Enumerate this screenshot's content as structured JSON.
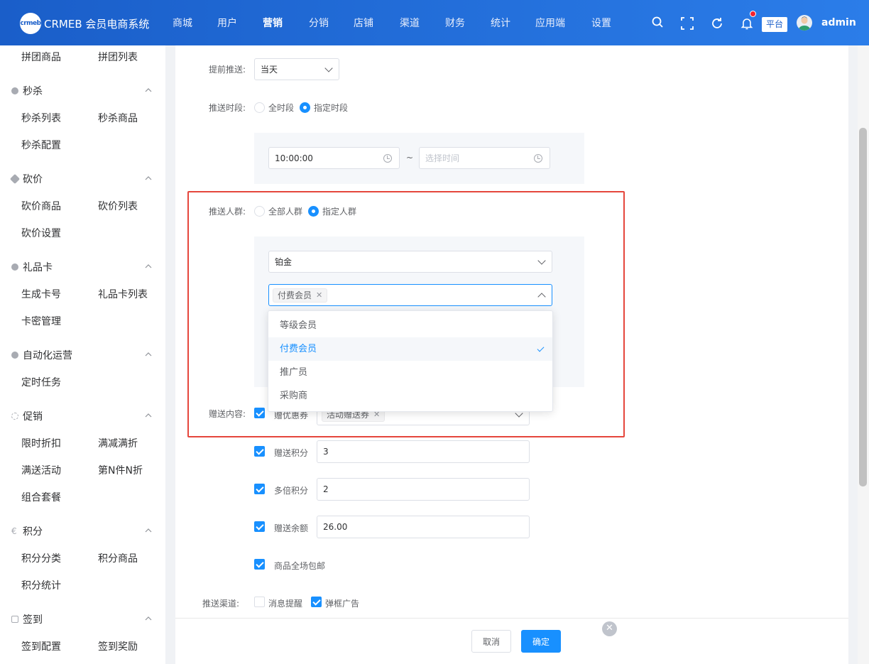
{
  "app": {
    "logo_text": "crmeb",
    "title": "CRMEB 会员电商系统"
  },
  "topnav": [
    "商城",
    "用户",
    "营销",
    "分销",
    "店铺",
    "渠道",
    "财务",
    "统计",
    "应用端",
    "设置"
  ],
  "header": {
    "platform_label": "平台",
    "username": "admin"
  },
  "sidebar": {
    "top_items": [
      "拼团商品",
      "拼团列表"
    ],
    "groups": [
      {
        "title": "秒杀",
        "items": [
          "秒杀列表",
          "秒杀商品",
          "秒杀配置"
        ]
      },
      {
        "title": "砍价",
        "items": [
          "砍价商品",
          "砍价列表",
          "砍价设置"
        ]
      },
      {
        "title": "礼品卡",
        "items": [
          "生成卡号",
          "礼品卡列表",
          "卡密管理"
        ]
      },
      {
        "title": "自动化运营",
        "items": [
          "定时任务"
        ]
      },
      {
        "title": "促销",
        "items": [
          "限时折扣",
          "满减满折",
          "满送活动",
          "第N件N折",
          "组合套餐"
        ]
      },
      {
        "title": "积分",
        "items": [
          "积分分类",
          "积分商品",
          "积分统计"
        ]
      },
      {
        "title": "签到",
        "items": [
          "签到配置",
          "签到奖励"
        ]
      }
    ]
  },
  "form": {
    "advance_push": {
      "label": "提前推送:",
      "value": "当天"
    },
    "push_period": {
      "label": "推送时段:",
      "options": [
        "全时段",
        "指定时段"
      ],
      "selected": "指定时段"
    },
    "time_range": {
      "start": "10:00:00",
      "separator": "~",
      "end_placeholder": "选择时间"
    },
    "push_crowd": {
      "label": "推送人群:",
      "options": [
        "全部人群",
        "指定人群"
      ],
      "selected": "指定人群"
    },
    "level_select": {
      "value": "铂金"
    },
    "member_type_select": {
      "tags": [
        "付费会员"
      ]
    },
    "member_type_dropdown": {
      "options": [
        "等级会员",
        "付费会员",
        "推广员",
        "采购商"
      ],
      "selected": "付费会员"
    },
    "gift": {
      "label": "赠送内容:",
      "coupon": {
        "label": "赠优惠券",
        "checked": true,
        "tags": [
          "活动赠送券"
        ]
      },
      "points": {
        "label": "赠送积分",
        "checked": true,
        "value": "3"
      },
      "multi_points": {
        "label": "多倍积分",
        "checked": true,
        "value": "2"
      },
      "balance": {
        "label": "赠送余额",
        "checked": true,
        "value": "26.00"
      },
      "free_shipping": {
        "label": "商品全场包邮",
        "checked": true
      }
    },
    "push_channel": {
      "label": "推送渠道:",
      "options": [
        {
          "label": "消息提醒",
          "checked": false
        },
        {
          "label": "弹框广告",
          "checked": true
        }
      ]
    }
  },
  "footer": {
    "cancel": "取消",
    "confirm": "确定"
  },
  "colors": {
    "primary": "#1890ff",
    "highlight_border": "#e5463c",
    "topbar": "#1a5ec9"
  }
}
